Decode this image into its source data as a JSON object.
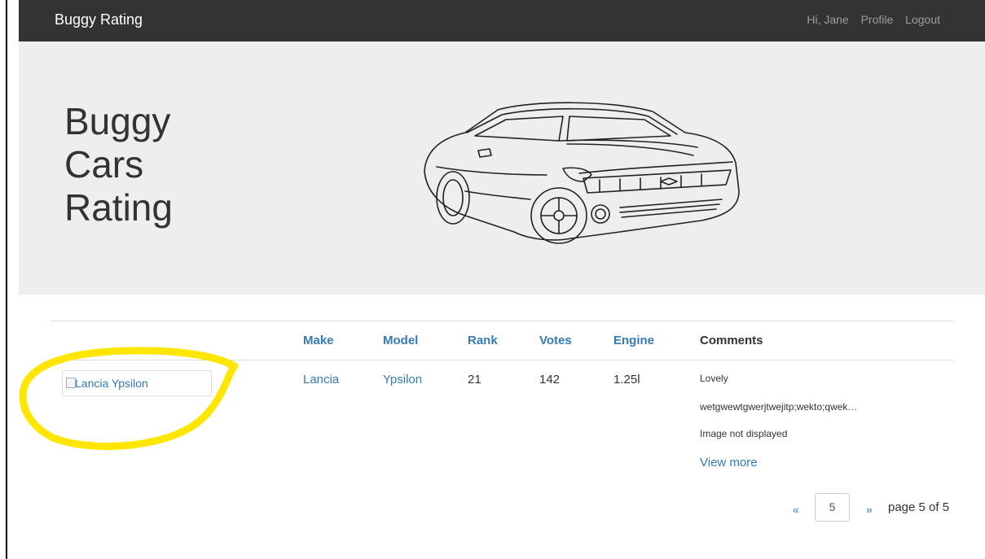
{
  "navbar": {
    "brand": "Buggy Rating",
    "greeting": "Hi, Jane",
    "profile": "Profile",
    "logout": "Logout"
  },
  "hero": {
    "title_lines": [
      "Buggy",
      "Cars",
      "Rating"
    ],
    "image_icon": "car-sketch-icon"
  },
  "table": {
    "headers": [
      "Make",
      "Model",
      "Rank",
      "Votes",
      "Engine",
      "Comments"
    ],
    "rows": [
      {
        "image_alt": "Lancia Ypsilon",
        "make": "Lancia",
        "model": "Ypsilon",
        "rank": "21",
        "votes": "142",
        "engine": "1.25l",
        "comments": [
          "Lovely",
          "wetgwewtgwerjtwejitp;wekto;qwek…",
          "Image not displayed"
        ],
        "view_more": "View more"
      }
    ]
  },
  "pagination": {
    "prev": "«",
    "current": "5",
    "next": "»",
    "label": "page 5 of 5"
  },
  "colors": {
    "navbar": "#333333",
    "hero": "#eceeef",
    "link": "#337ab7",
    "highlight": "#ffe600"
  }
}
